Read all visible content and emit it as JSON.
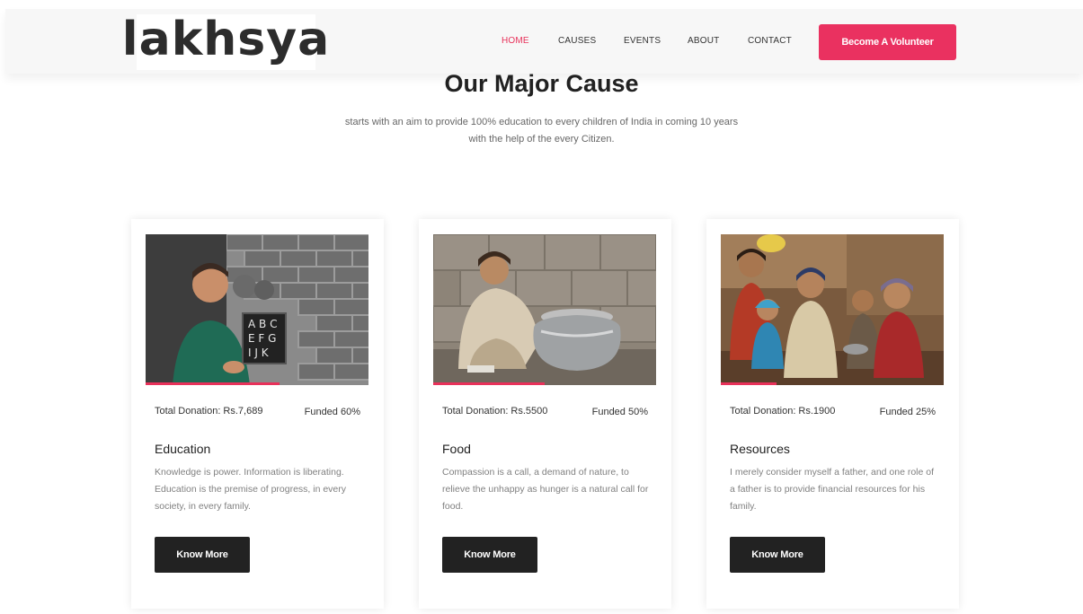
{
  "header": {
    "logo": "lakhsya",
    "nav": [
      {
        "label": "HOME",
        "active": true
      },
      {
        "label": "CAUSES",
        "active": false
      },
      {
        "label": "EVENTS",
        "active": false
      },
      {
        "label": "ABOUT",
        "active": false
      },
      {
        "label": "CONTACT",
        "active": false
      }
    ],
    "cta_label": "Become A Volunteer"
  },
  "section": {
    "title": "Our Major Cause",
    "subtitle_line1": "starts with an aim to provide 100% education to every children of India in coming 10 years",
    "subtitle_line2": "with the help of the every Citizen."
  },
  "cards": [
    {
      "image": "children-with-chalkboard-photo",
      "donation": "Total Donation: Rs.7,689",
      "funded": "Funded 60%",
      "funded_fraction": 0.6,
      "title": "Education",
      "description": "Knowledge is power. Information is liberating. Education is the premise of progress, in every society, in every family.",
      "button": "Know More"
    },
    {
      "image": "girl-with-cooking-pot-photo",
      "donation": "Total Donation: Rs.5500",
      "funded": "Funded 50%",
      "funded_fraction": 0.5,
      "title": "Food",
      "description": "Compassion is a call, a demand of nature, to relieve the unhappy as hunger is a natural call for food.",
      "button": "Know More"
    },
    {
      "image": "group-of-children-photo",
      "donation": "Total Donation: Rs.1900",
      "funded": "Funded 25%",
      "funded_fraction": 0.25,
      "title": "Resources",
      "description": "I merely consider myself a father, and one role of a father is to provide financial resources for his family.",
      "button": "Know More"
    }
  ],
  "colors": {
    "accent": "#e8315a",
    "button_dark": "#222222",
    "header_bg": "#f7f7f7"
  }
}
